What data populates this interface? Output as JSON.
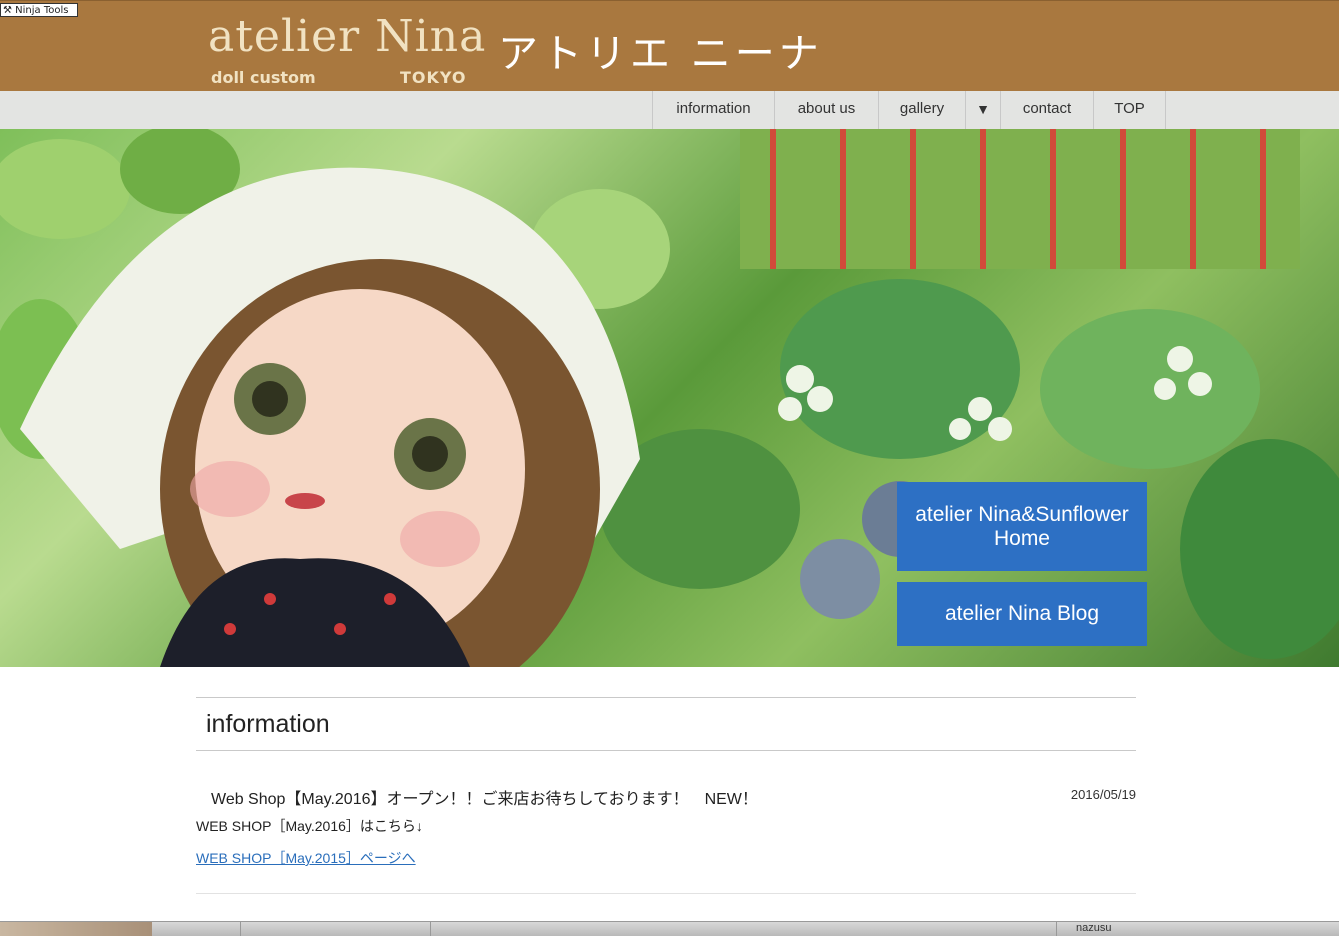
{
  "toolbar": {
    "ninja_label": "Ninja Tools"
  },
  "header": {
    "logo_main": "atelier Nina",
    "logo_sub": "doll custom",
    "logo_tokyo": "TOKYO",
    "logo_jp": "アトリエ ニーナ"
  },
  "nav": {
    "items": [
      "information",
      "about us",
      "gallery",
      "▼",
      "contact",
      "TOP"
    ]
  },
  "hero": {
    "button_home_line1": "atelier Nina&Sunflower",
    "button_home_line2": "Home",
    "button_blog": "atelier Nina Blog"
  },
  "content": {
    "section_title": "information",
    "post_title": "Web Shop【May.2016】オープン！！ご来店お待ちしております！　NEW！",
    "post_date": "2016/05/19",
    "post_body": "WEB SHOP［May.2016］はこちら↓",
    "post_link": "WEB SHOP［May.2015］ページへ"
  },
  "os": {
    "label": "nazusu"
  },
  "colors": {
    "header_bg": "#a9783f",
    "nav_bg": "#e3e4e2",
    "button_blue": "#2d70c4",
    "link_blue": "#2a6ebb"
  }
}
